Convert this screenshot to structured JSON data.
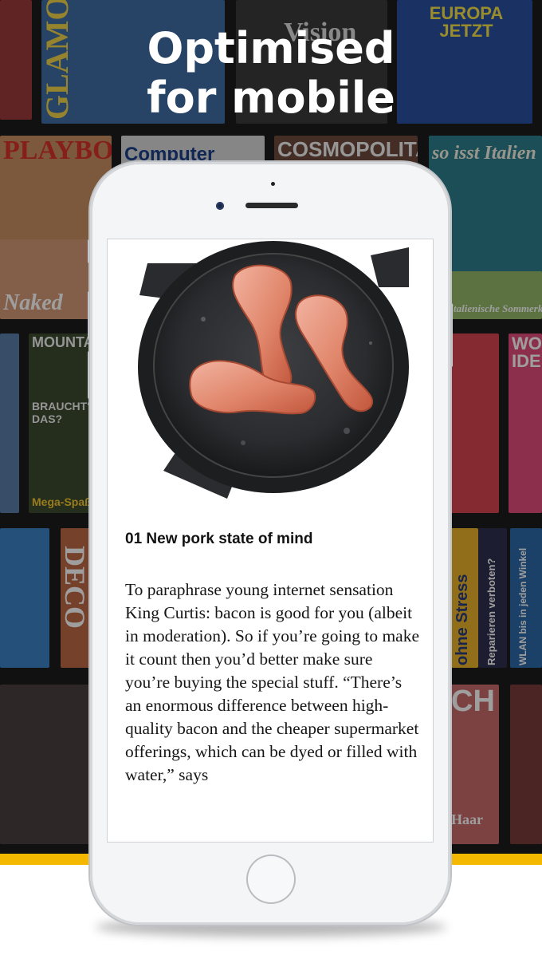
{
  "promo": {
    "headline_line1": "Optimised",
    "headline_line2": "for mobile"
  },
  "magazines": [
    {
      "title": "GLAMOUR",
      "color": "#3f6fa6",
      "text_color": "#f1d54a"
    },
    {
      "title": "Vision",
      "color": "#3a3a3a",
      "text_color": "#dddddd"
    },
    {
      "title": "EUROPA JETZT",
      "color": "#2b4fa0",
      "text_color": "#f6e24a"
    },
    {
      "title": "PLAYBOY",
      "color": "#c98e63",
      "text_color": "#d8322b"
    },
    {
      "title": "Computer",
      "color": "#d9d9d9",
      "text_color": "#1a3f8a"
    },
    {
      "title": "COSMOPOLITAN",
      "color": "#6e4a3c",
      "text_color": "#f2f2f2"
    },
    {
      "title": "so isst Italien",
      "color": "#2d7f8c",
      "text_color": "#f6f1e3"
    },
    {
      "title": "Naked",
      "color": "#d39a78",
      "text_color": "#ffffff"
    },
    {
      "title": "Italienische Sommerküche",
      "color": "#96b86a",
      "text_color": "#ffffff"
    },
    {
      "title": "MOUNTAIN",
      "color": "#3d4a2f",
      "text_color": "#f0f0f0"
    },
    {
      "title": "BRAUCHT'S DAS?",
      "color": "#2e3a2a",
      "text_color": "#ffffff"
    },
    {
      "title": "Mega-Spaß",
      "color": "#3a4e6c",
      "text_color": "#f5c730"
    },
    {
      "title": "WOMAN IDEE",
      "color": "#e24d7b",
      "text_color": "#ffffff"
    },
    {
      "title": "DECO",
      "color": "#bf6a45",
      "text_color": "#ffffff"
    },
    {
      "title": "ohne Stress",
      "color": "#e8b22a",
      "text_color": "#2a3c7a"
    },
    {
      "title": "Reparieren verboten?",
      "color": "#2f2f4f",
      "text_color": "#ffffff"
    },
    {
      "title": "WLAN bis in jeden Winkel",
      "color": "#2c6aa8",
      "text_color": "#ffffff"
    },
    {
      "title": "CH",
      "color": "#c96a6a",
      "text_color": "#ffffff"
    },
    {
      "title": "Haar",
      "color": "#6a4a44",
      "text_color": "#ffffff"
    }
  ],
  "article": {
    "title": "01 New pork state of mind",
    "body": "To paraphrase young internet sensation King Curtis: bacon is good for you (albeit in moderation). So if you’re going to make it count then you’d better make sure you’re buying the special stuff. “There’s an enormous difference between high-quality bacon and the cheaper supermarket offerings, which can be dyed or filled with water,” says",
    "image": "bacon-in-cast-iron-pan"
  },
  "colors": {
    "accent": "#f5b800",
    "headline": "#ffffff",
    "phone_body": "#f4f5f6"
  }
}
